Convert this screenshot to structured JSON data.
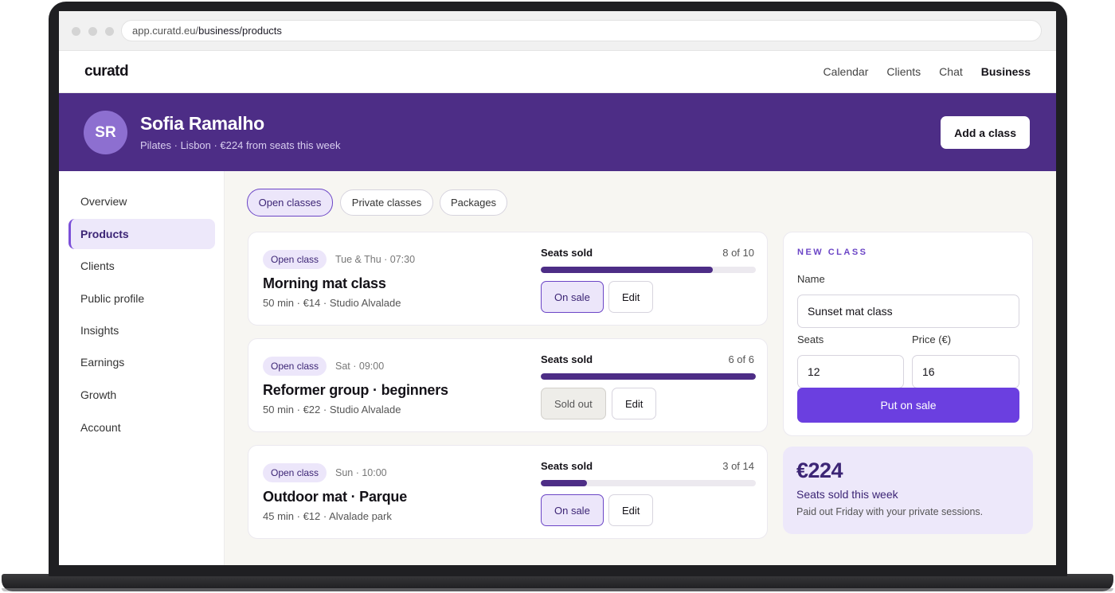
{
  "browser": {
    "url_prefix": "app.curatd.eu/",
    "url_path": "business/products"
  },
  "topnav": {
    "logo": "curatd",
    "links": [
      "Calendar",
      "Clients",
      "Chat",
      "Business"
    ]
  },
  "profile": {
    "initials": "SR",
    "name": "Sofia Ramalho",
    "subtitle": "Pilates · Lisbon · €224 from seats this week",
    "add_button": "Add a class"
  },
  "sidebar": {
    "items": [
      "Overview",
      "Products",
      "Clients",
      "Public profile",
      "Insights",
      "Earnings",
      "Growth",
      "Account"
    ],
    "active": "Products"
  },
  "tabs": [
    "Open classes",
    "Private classes",
    "Packages"
  ],
  "classes": [
    {
      "tag": "Open class",
      "when": "Tue & Thu · 07:30",
      "title": "Morning mat class",
      "meta": "50 min · €14 · Studio Alvalade",
      "seats_label": "Seats sold",
      "seats_text": "8 of 10",
      "fill": 0.8,
      "state": "On sale",
      "edit": "Edit"
    },
    {
      "tag": "Open class",
      "when": "Sat · 09:00",
      "title": "Reformer group · beginners",
      "meta": "50 min · €22 · Studio Alvalade",
      "seats_label": "Seats sold",
      "seats_text": "6 of 6",
      "fill": 1.0,
      "state": "Sold out",
      "edit": "Edit"
    },
    {
      "tag": "Open class",
      "when": "Sun · 10:00",
      "title": "Outdoor mat · Parque",
      "meta": "45 min · €12 · Alvalade park",
      "seats_label": "Seats sold",
      "seats_text": "3 of 14",
      "fill": 0.214,
      "state": "On sale",
      "edit": "Edit"
    }
  ],
  "new_class": {
    "heading": "NEW CLASS",
    "name_label": "Name",
    "name_value": "Sunset mat class",
    "seats_label": "Seats",
    "seats_value": "12",
    "price_label": "Price (€)",
    "price_value": "16",
    "submit": "Put on sale"
  },
  "summary": {
    "amount": "€224",
    "label": "Seats sold this week",
    "note": "Paid out Friday with your private sessions."
  },
  "colors": {
    "brand": "#4d2d86",
    "accent": "#6b3fe0",
    "tint": "#ede8fa"
  }
}
